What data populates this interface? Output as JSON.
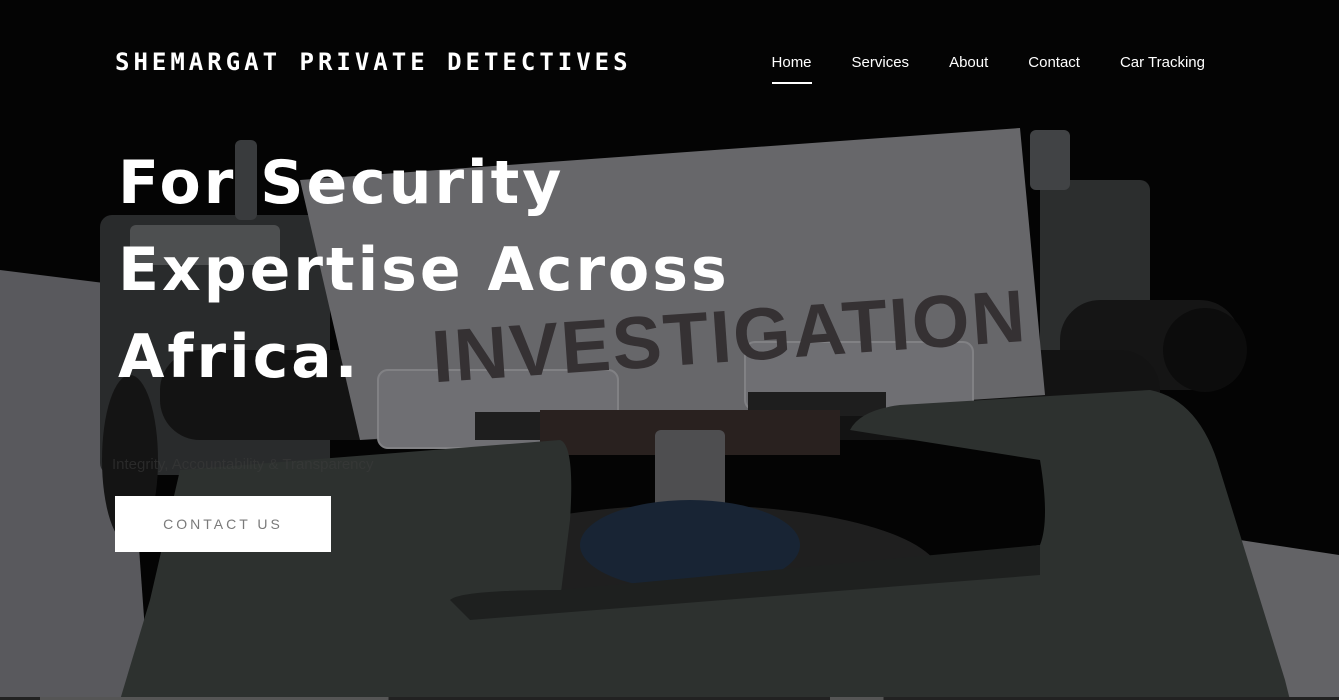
{
  "header": {
    "brand": "SHEMARGAT PRIVATE DETECTIVES",
    "nav": [
      {
        "label": "Home",
        "active": true
      },
      {
        "label": "Services",
        "active": false
      },
      {
        "label": "About",
        "active": false
      },
      {
        "label": "Contact",
        "active": false
      },
      {
        "label": "Car Tracking",
        "active": false
      }
    ]
  },
  "hero": {
    "title_line1": "For Security",
    "title_line2": "Expertise Across",
    "title_line3": "Africa.",
    "tagline": "Integrity, Accountability & Transparency",
    "cta_label": "CONTACT US",
    "background_image_text": "INVESTIGATION",
    "background_image_subject": "typewriter"
  },
  "colors": {
    "background": "#000000",
    "text": "#ffffff",
    "cta_background": "#ffffff",
    "cta_text": "#7a7a7a",
    "typewriter_body": "#3f4542",
    "paper": "#b9b9bd"
  }
}
